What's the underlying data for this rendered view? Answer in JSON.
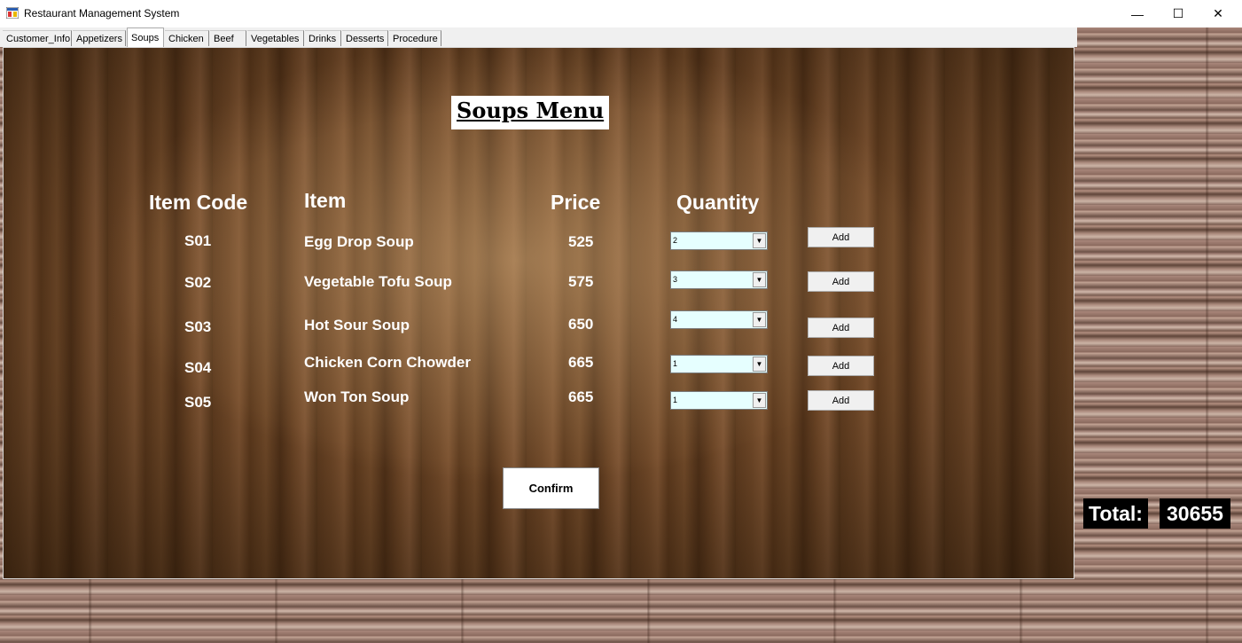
{
  "window": {
    "title": "Restaurant Management System",
    "minimize": "—",
    "maximize": "☐",
    "close": "✕"
  },
  "tabs": [
    {
      "label": "Customer_Info"
    },
    {
      "label": "Appetizers"
    },
    {
      "label": "Soups",
      "active": true
    },
    {
      "label": "Chicken"
    },
    {
      "label": "Beef"
    },
    {
      "label": "Vegetables"
    },
    {
      "label": "Drinks"
    },
    {
      "label": "Desserts"
    },
    {
      "label": "Procedure"
    }
  ],
  "menu": {
    "title": "Soups Menu",
    "headers": {
      "code": "Item Code",
      "item": "Item",
      "price": "Price",
      "quantity": "Quantity"
    },
    "rows": [
      {
        "code": "S01",
        "item": "Egg Drop Soup",
        "price": "525",
        "quantity": "2",
        "add_label": "Add"
      },
      {
        "code": "S02",
        "item": "Vegetable Tofu Soup",
        "price": "575",
        "quantity": "3",
        "add_label": "Add"
      },
      {
        "code": "S03",
        "item": "Hot  Sour Soup",
        "price": "650",
        "quantity": "4",
        "add_label": "Add"
      },
      {
        "code": "S04",
        "item": "Chicken Corn Chowder",
        "price": "665",
        "quantity": "1",
        "add_label": "Add"
      },
      {
        "code": "S05",
        "item": "Won Ton Soup",
        "price": "665",
        "quantity": "1",
        "add_label": "Add"
      }
    ],
    "confirm_label": "Confirm"
  },
  "total": {
    "label": "Total:",
    "value": "30655"
  },
  "colors": {
    "quantity_field_bg": "#e6ffff",
    "total_bg": "#000000"
  }
}
